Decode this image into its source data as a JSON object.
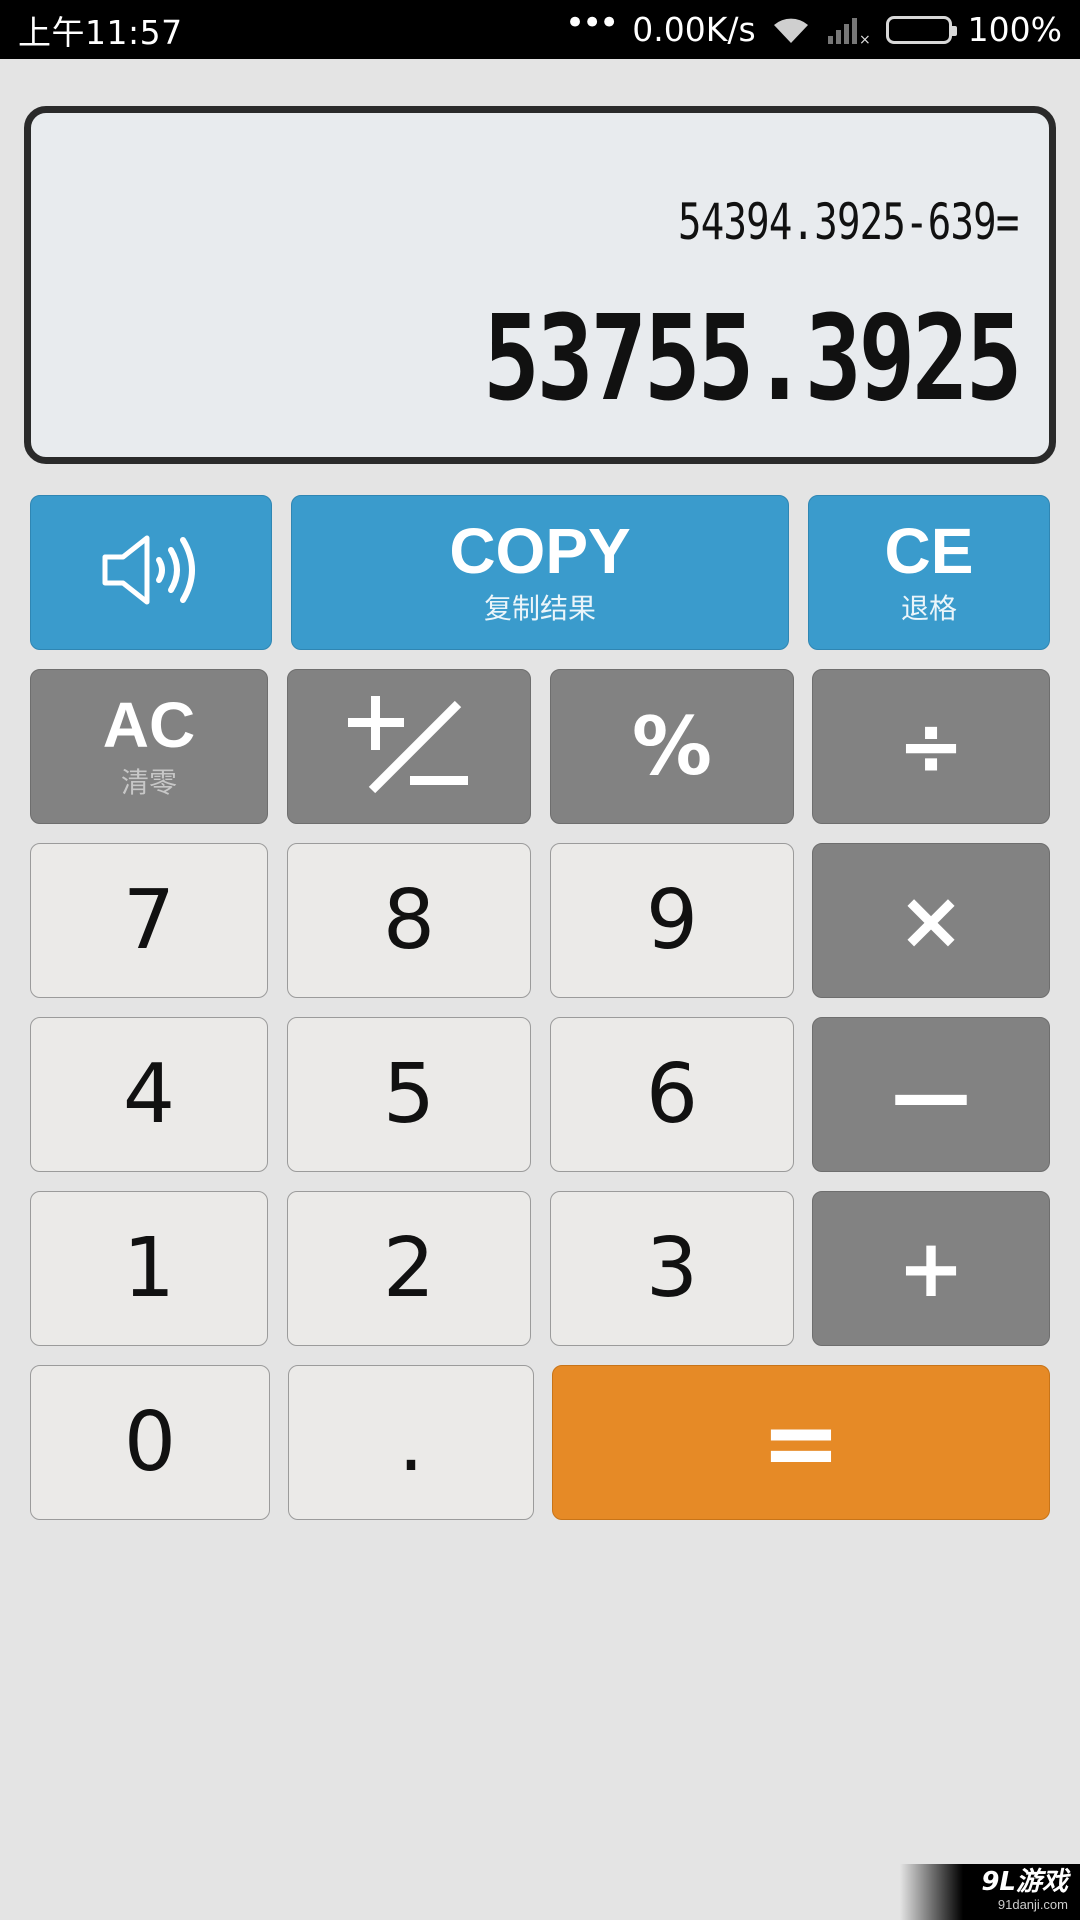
{
  "status_bar": {
    "time": "上午11:57",
    "dots": "•••",
    "speed": "0.00K/s",
    "battery": "100%",
    "battery_color": "#6fdc1f"
  },
  "display": {
    "expression": "54394.3925-639=",
    "result": "53755.3925"
  },
  "top_keys": {
    "sound_icon": "speaker-icon",
    "copy_label": "COPY",
    "copy_sub": "复制结果",
    "ce_label": "CE",
    "ce_sub": "退格"
  },
  "function_keys": {
    "ac_label": "AC",
    "ac_sub": "清零",
    "plus_minus_icon": "plus-minus-icon",
    "percent": "%",
    "divide": "÷"
  },
  "digits": {
    "d7": "7",
    "d8": "8",
    "d9": "9",
    "d4": "4",
    "d5": "5",
    "d6": "6",
    "d1": "1",
    "d2": "2",
    "d3": "3",
    "d0": "0",
    "dot": "."
  },
  "operators": {
    "multiply": "×",
    "minus": "—",
    "plus": "+",
    "equals": "="
  },
  "colors": {
    "blue": "#3a9bcc",
    "gray": "#828282",
    "light": "#ebeae8",
    "orange": "#e68a26"
  },
  "watermark": {
    "brand": "9L游戏",
    "url": "91danji.com"
  }
}
